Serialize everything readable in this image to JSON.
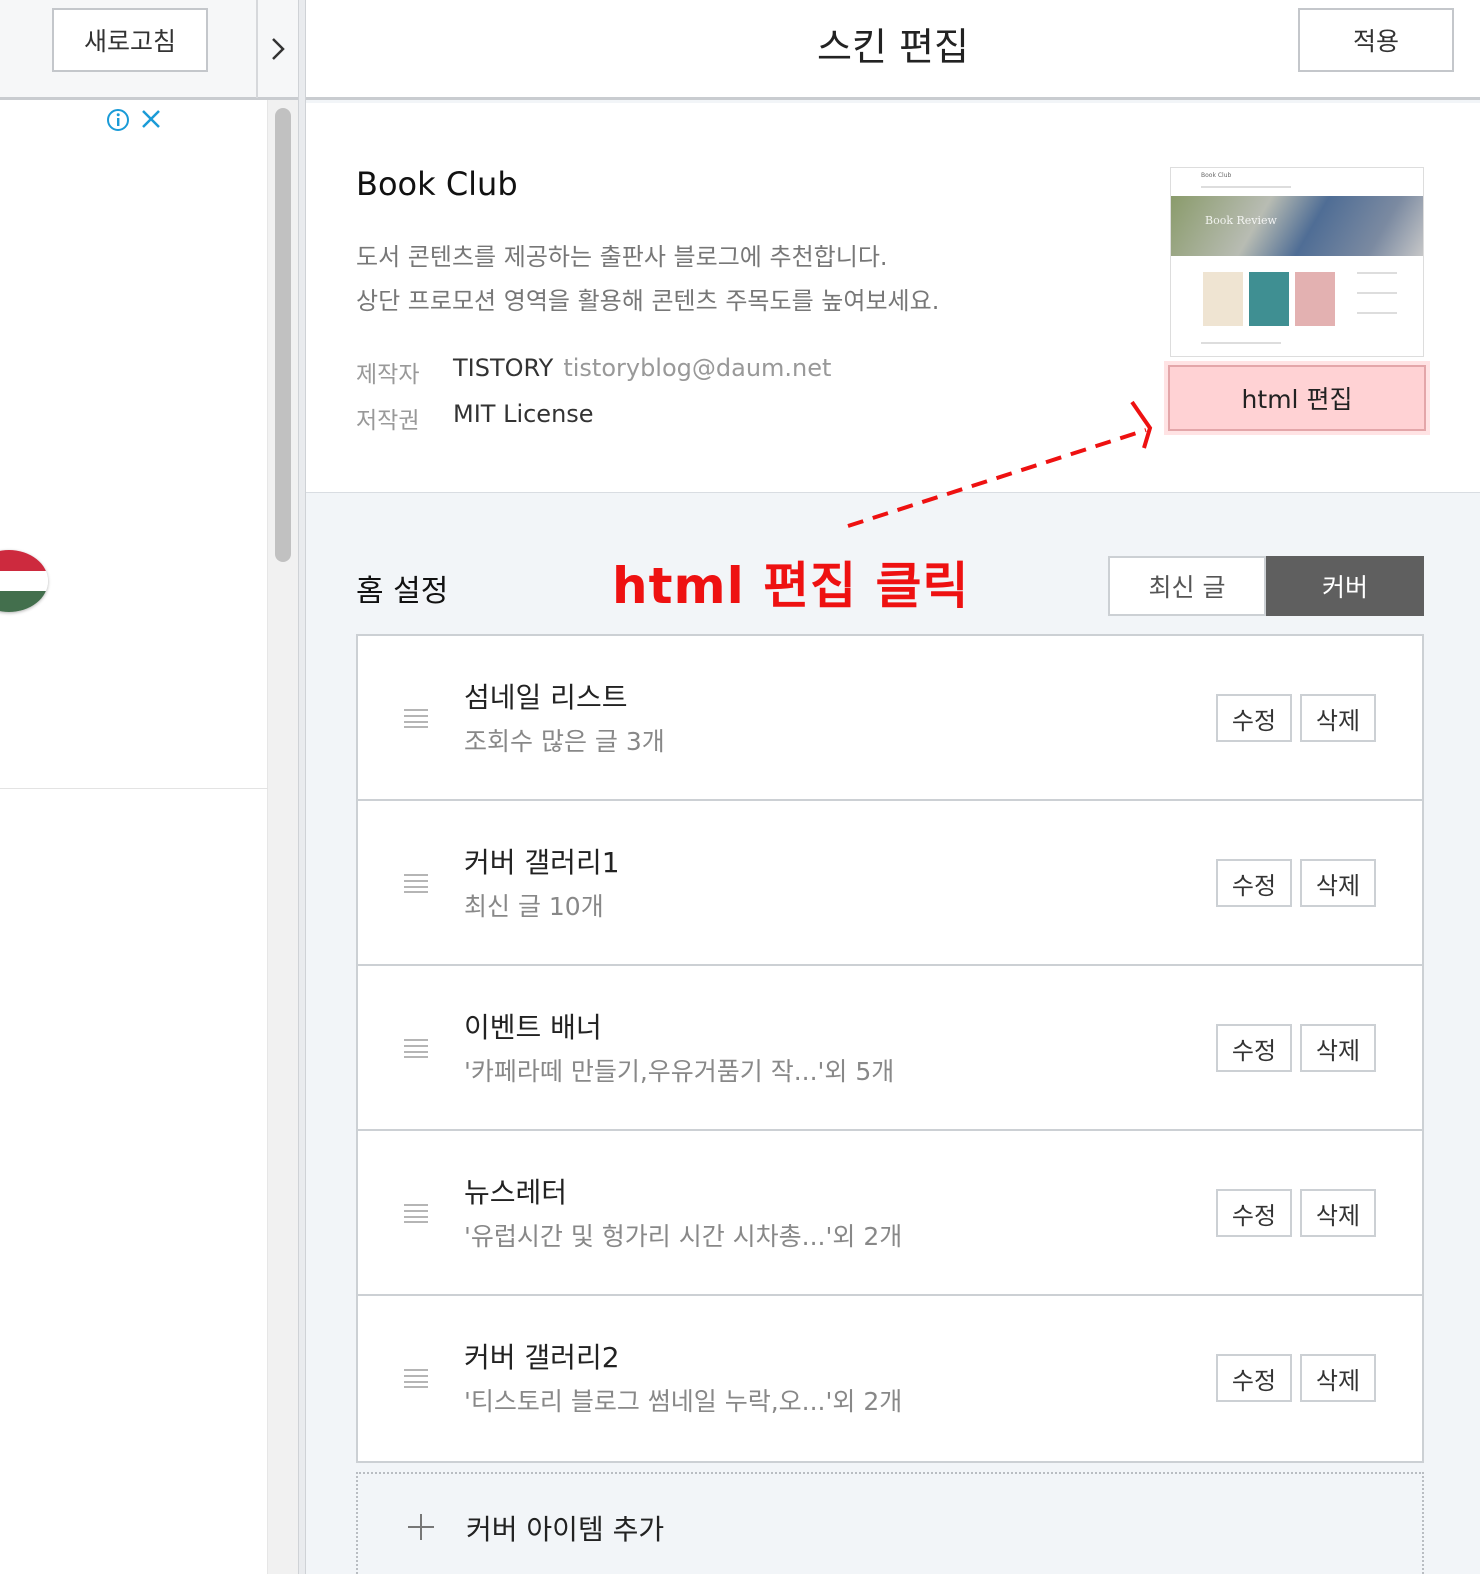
{
  "left_pane": {
    "refresh_label": "새로고침",
    "toggle_icon": "chevron-right-icon",
    "ad_icons": [
      "info-icon",
      "close-icon"
    ],
    "flag_icon": "hungary-flag-icon"
  },
  "header": {
    "title": "스킨 편집",
    "apply_label": "적용"
  },
  "skin": {
    "name": "Book Club",
    "description_lines": [
      "도서 콘텐츠를 제공하는 출판사 블로그에 추천합니다.",
      "상단 프로모션 영역을 활용해 콘텐츠 주목도를 높여보세요."
    ],
    "author_label": "제작자",
    "author": "TISTORY",
    "author_email": "tistoryblog@daum.net",
    "license_label": "저작권",
    "license": "MIT License",
    "thumbnail": {
      "header_text": "Book Club",
      "banner_text": "Book Review"
    },
    "html_edit_label": "html 편집"
  },
  "annotation": {
    "text": "html 편집 클릭",
    "color": "#ee1111"
  },
  "home_settings": {
    "title": "홈 설정",
    "tabs": [
      {
        "label": "최신 글",
        "active": false
      },
      {
        "label": "커버",
        "active": true
      }
    ],
    "items": [
      {
        "title": "섬네일 리스트",
        "subtitle": "조회수 많은 글 3개",
        "edit_label": "수정",
        "delete_label": "삭제"
      },
      {
        "title": "커버 갤러리1",
        "subtitle": "최신 글 10개",
        "edit_label": "수정",
        "delete_label": "삭제"
      },
      {
        "title": "이벤트 배너",
        "subtitle": "'카페라떼 만들기,우유거품기 작...'외 5개",
        "edit_label": "수정",
        "delete_label": "삭제"
      },
      {
        "title": "뉴스레터",
        "subtitle": "'유럽시간 및 헝가리 시간 시차총...'외 2개",
        "edit_label": "수정",
        "delete_label": "삭제"
      },
      {
        "title": "커버 갤러리2",
        "subtitle": "'티스토리 블로그 썸네일 누락,오...'외 2개",
        "edit_label": "수정",
        "delete_label": "삭제"
      }
    ],
    "add_label": "커버 아이템 추가"
  },
  "colors": {
    "accent_dark": "#5f5f5f",
    "highlight": "#ffd2d4",
    "info_blue": "#1a9bd7"
  }
}
